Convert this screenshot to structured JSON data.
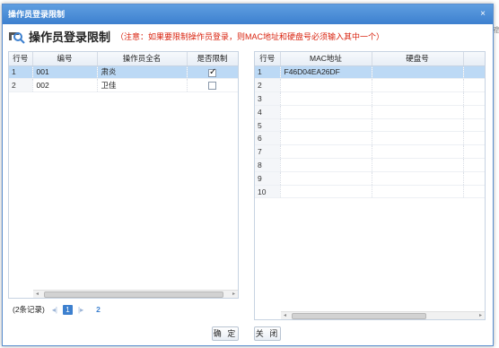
{
  "window": {
    "title": "操作员登录限制",
    "close_glyph": "×"
  },
  "backdrop": {
    "edge_text": "宿"
  },
  "header": {
    "title": "操作员登录限制",
    "note": "（注意：如果要限制操作员登录，则MAC地址和硬盘号必须输入其中一个）"
  },
  "left_grid": {
    "columns": [
      "行号",
      "编号",
      "操作员全名",
      "是否限制"
    ],
    "rows": [
      {
        "rn": "1",
        "code": "001",
        "name": "肃炎",
        "restricted": true
      },
      {
        "rn": "2",
        "code": "002",
        "name": "卫佳",
        "restricted": false
      }
    ]
  },
  "pager": {
    "summary": "(2条记录)",
    "prev_icon": "prev-icon",
    "next_icon": "next-icon",
    "current_page": "1",
    "page_link": "2"
  },
  "right_grid": {
    "columns": [
      "行号",
      "MAC地址",
      "硬盘号"
    ],
    "rows": [
      {
        "rn": "1",
        "mac": "F46D04EA26DF",
        "disk": ""
      },
      {
        "rn": "2",
        "mac": "",
        "disk": ""
      },
      {
        "rn": "3",
        "mac": "",
        "disk": ""
      },
      {
        "rn": "4",
        "mac": "",
        "disk": ""
      },
      {
        "rn": "5",
        "mac": "",
        "disk": ""
      },
      {
        "rn": "6",
        "mac": "",
        "disk": ""
      },
      {
        "rn": "7",
        "mac": "",
        "disk": ""
      },
      {
        "rn": "8",
        "mac": "",
        "disk": ""
      },
      {
        "rn": "9",
        "mac": "",
        "disk": ""
      },
      {
        "rn": "10",
        "mac": "",
        "disk": ""
      }
    ]
  },
  "buttons": {
    "ok": "确 定",
    "close": "关 闭"
  },
  "colors": {
    "accent": "#3d80cf",
    "note": "#d9230f",
    "selection": "#bcd9f5"
  }
}
